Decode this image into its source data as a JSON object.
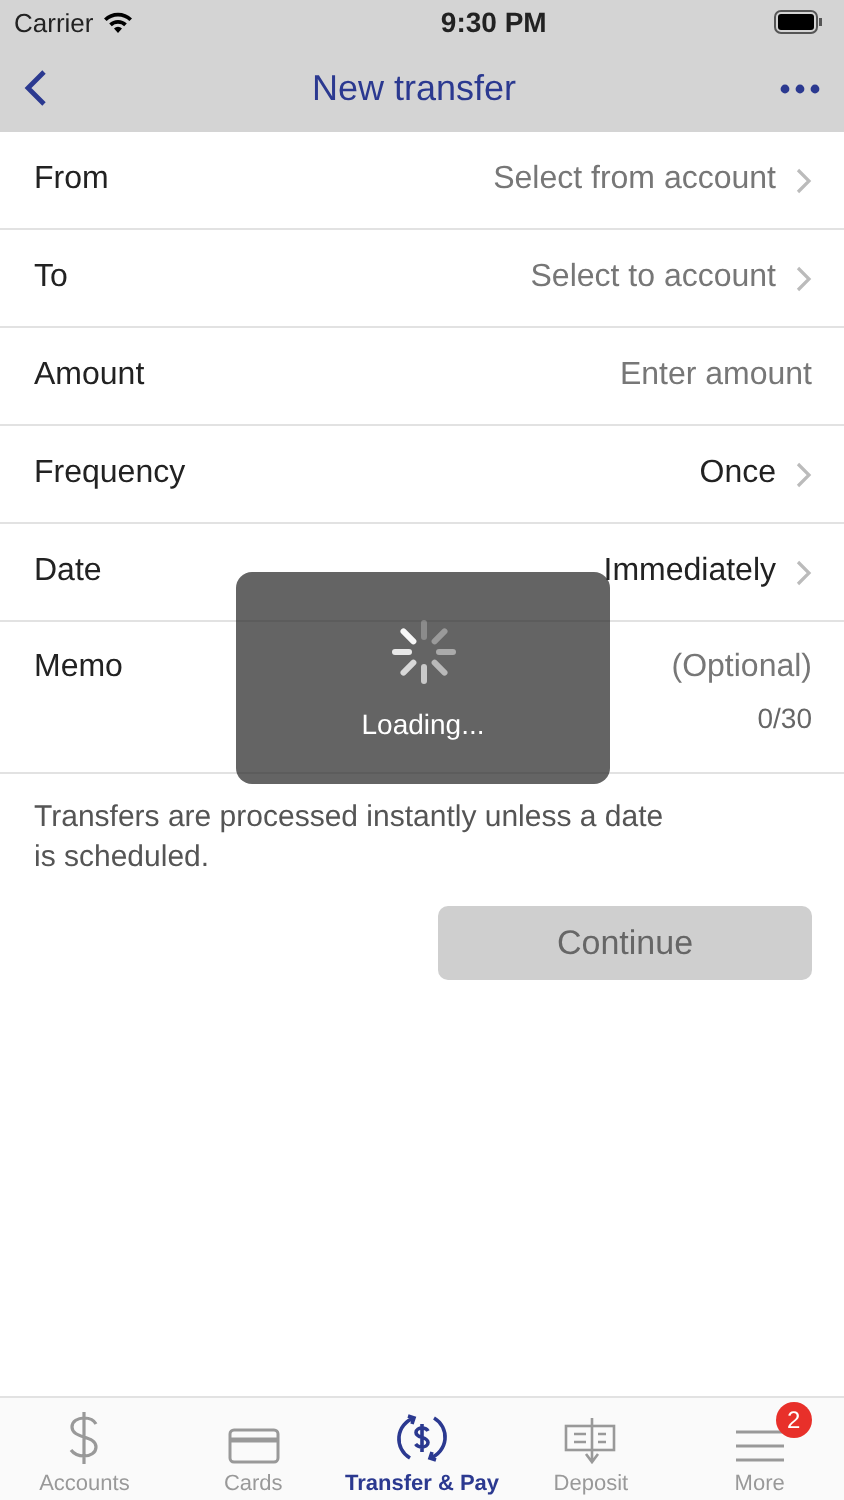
{
  "status_bar": {
    "carrier": "Carrier",
    "time": "9:30 PM"
  },
  "nav_bar": {
    "title": "New transfer"
  },
  "form_rows": [
    {
      "kind": "select",
      "label": "From",
      "placeholder": "Select from account"
    },
    {
      "kind": "select",
      "label": "To",
      "placeholder": "Select to account"
    },
    {
      "kind": "input",
      "label": "Amount",
      "placeholder": "Enter amount"
    },
    {
      "kind": "select",
      "label": "Frequency",
      "value": "Once"
    },
    {
      "kind": "select",
      "label": "Date",
      "value": "Immediately"
    },
    {
      "kind": "memo",
      "label": "Memo",
      "placeholder": "(Optional)",
      "counter": "0/30"
    }
  ],
  "note": "Transfers are processed instantly unless a date is scheduled.",
  "continue_button": {
    "label": "Continue",
    "disabled": true
  },
  "loading_overlay": {
    "text": "Loading..."
  },
  "tab_bar": [
    {
      "kind": "accounts",
      "label": "Accounts",
      "selected": false
    },
    {
      "kind": "cards",
      "label": "Cards",
      "selected": false
    },
    {
      "kind": "transfer",
      "label": "Transfer & Pay",
      "selected": true
    },
    {
      "kind": "deposit",
      "label": "Deposit",
      "selected": false
    },
    {
      "kind": "more",
      "label": "More",
      "selected": false,
      "badge": "2"
    }
  ]
}
